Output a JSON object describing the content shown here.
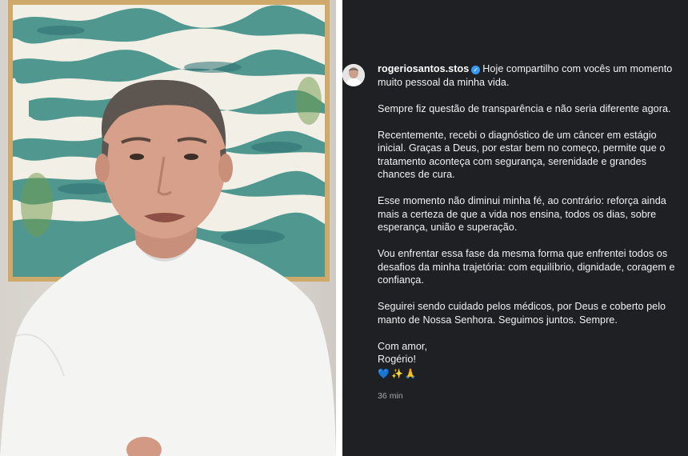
{
  "post": {
    "username": "rogeriosantos.stos",
    "verified_icon": "verified-badge-icon",
    "intro": "Hoje compartilho com vocês um momento muito pessoal da minha vida.",
    "paragraphs": [
      "Sempre fiz questão de transparência e não seria diferente agora.",
      "Recentemente, recebi o diagnóstico de um câncer em estágio inicial. Graças a Deus, por estar bem no começo, permite que o tratamento aconteça com segurança, serenidade e grandes chances de cura.",
      "Esse momento não diminui minha fé, ao contrário: reforça ainda mais a certeza de que a vida nos ensina, todos os dias, sobre esperança, união e superação.",
      "Vou enfrentar essa fase da mesma forma que enfrentei todos os desafios da minha trajetória: com equilíbrio, dignidade, coragem e confiança.",
      "Seguirei sendo cuidado pelos médicos, por Deus e coberto pelo manto de Nossa Senhora. Seguimos juntos. Sempre."
    ],
    "signoff_line1": "Com amor,",
    "signoff_line2": "Rogério!",
    "emojis": "💙✨🙏",
    "timestamp": "36 min"
  },
  "colors": {
    "caption_background": "#1f2024",
    "caption_text": "#f2f2f2",
    "verified_blue": "#3897f0",
    "timestamp_gray": "#a8a8a8"
  }
}
